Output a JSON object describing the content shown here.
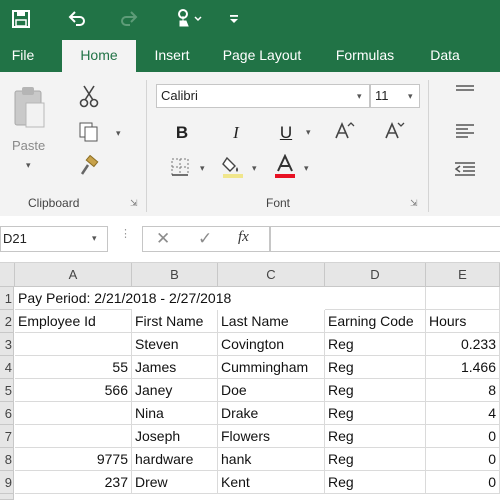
{
  "colors": {
    "brand": "#217346",
    "ribbon_bg": "#f3f3f3",
    "font_color_bar": "#e81123"
  },
  "quick_access": {
    "save_icon": "save-icon",
    "undo_icon": "undo-icon",
    "redo_icon": "redo-icon",
    "touch_mode_icon": "touch-mode-icon",
    "customize_icon": "customize-toolbar-icon"
  },
  "tabs": [
    {
      "label": "File"
    },
    {
      "label": "Home",
      "active": true
    },
    {
      "label": "Insert"
    },
    {
      "label": "Page Layout"
    },
    {
      "label": "Formulas"
    },
    {
      "label": "Data"
    }
  ],
  "ribbon": {
    "clipboard": {
      "label": "Clipboard",
      "paste_label": "Paste"
    },
    "font": {
      "label": "Font",
      "font_name": "Calibri",
      "font_size": "11"
    }
  },
  "formula_bar": {
    "name_box": "D21",
    "fx_label": "fx",
    "formula": ""
  },
  "sheet": {
    "columns": [
      "A",
      "B",
      "C",
      "D",
      "E"
    ],
    "rows": [
      {
        "num": "1",
        "cells": [
          "Pay Period: 2/21/2018 - 2/27/2018",
          "",
          "",
          "",
          ""
        ]
      },
      {
        "num": "2",
        "cells": [
          "Employee Id",
          "First Name",
          "Last Name",
          "Earning Code",
          "Hours"
        ]
      },
      {
        "num": "3",
        "cells": [
          "",
          "Steven",
          "Covington",
          "Reg",
          "0.233"
        ]
      },
      {
        "num": "4",
        "cells": [
          "55",
          "James",
          "Cummingham",
          "Reg",
          "1.466"
        ]
      },
      {
        "num": "5",
        "cells": [
          "566",
          "Janey",
          "Doe",
          "Reg",
          "8"
        ]
      },
      {
        "num": "6",
        "cells": [
          "",
          "Nina",
          "Drake",
          "Reg",
          "4"
        ]
      },
      {
        "num": "7",
        "cells": [
          "",
          "Joseph",
          "Flowers",
          "Reg",
          "0"
        ]
      },
      {
        "num": "8",
        "cells": [
          "9775",
          "hardware",
          "hank",
          "Reg",
          "0"
        ]
      },
      {
        "num": "9",
        "cells": [
          "237",
          "Drew",
          "Kent",
          "Reg",
          "0"
        ]
      }
    ]
  }
}
